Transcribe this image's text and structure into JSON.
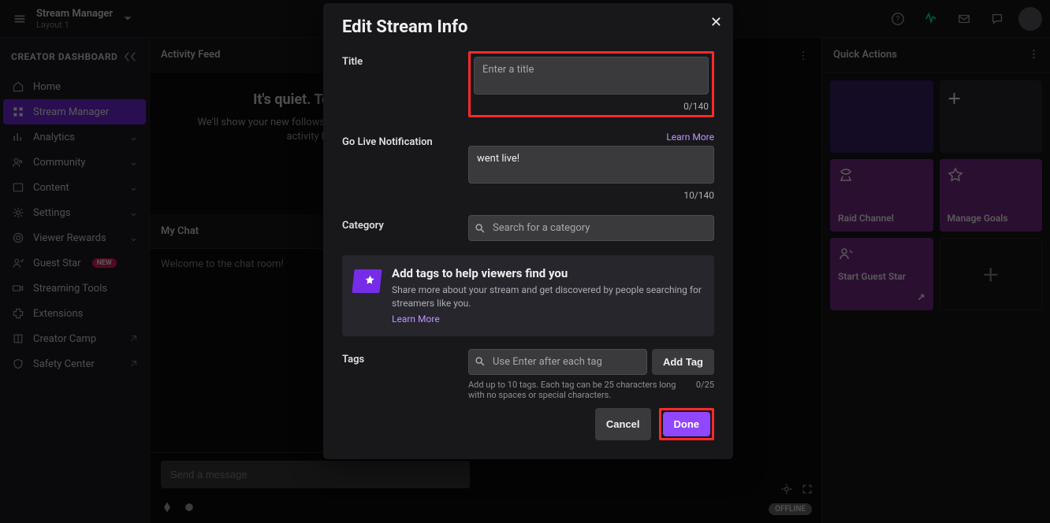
{
  "topbar": {
    "breadcrumb_main": "Stream Manager",
    "breadcrumb_sub": "Layout 1"
  },
  "sidebar": {
    "header": "CREATOR DASHBOARD",
    "items": [
      {
        "label": "Home",
        "icon": "home"
      },
      {
        "label": "Stream Manager",
        "icon": "grid",
        "active": true
      },
      {
        "label": "Analytics",
        "icon": "chart",
        "expandable": true
      },
      {
        "label": "Community",
        "icon": "people",
        "expandable": true
      },
      {
        "label": "Content",
        "icon": "content",
        "expandable": true
      },
      {
        "label": "Settings",
        "icon": "gear",
        "expandable": true
      },
      {
        "label": "Viewer Rewards",
        "icon": "reward",
        "expandable": true
      },
      {
        "label": "Guest Star",
        "icon": "guest",
        "badge": "NEW"
      },
      {
        "label": "Streaming Tools",
        "icon": "camera"
      },
      {
        "label": "Extensions",
        "icon": "ext"
      },
      {
        "label": "Creator Camp",
        "icon": "book",
        "external": true
      },
      {
        "label": "Safety Center",
        "icon": "shield",
        "external": true
      }
    ]
  },
  "activity": {
    "panel_title": "Activity Feed",
    "empty_heading": "It's quiet. Too quiet.",
    "empty_body": "We'll show your new follows, subs, cheers, and raids activity here."
  },
  "chat": {
    "panel_title": "My Chat",
    "welcome": "Welcome to the chat room!",
    "input_placeholder": "Send a message"
  },
  "preview": {
    "offline": "OFFLINE",
    "offline_pill": "OFFLINE"
  },
  "quick": {
    "panel_title": "Quick Actions",
    "tiles": [
      {
        "label": ""
      },
      {
        "label": ""
      },
      {
        "label": "Raid Channel"
      },
      {
        "label": "Manage Goals"
      },
      {
        "label": "Start Guest Star"
      }
    ]
  },
  "modal": {
    "title": "Edit Stream Info",
    "title_label": "Title",
    "title_placeholder": "Enter a title",
    "title_counter": "0/140",
    "golive_label": "Go Live Notification",
    "golive_learn": "Learn More",
    "golive_value": "went live!",
    "golive_counter": "10/140",
    "category_label": "Category",
    "category_placeholder": "Search for a category",
    "promo_heading": "Add tags to help viewers find you",
    "promo_body": "Share more about your stream and get discovered by people searching for streamers like you.",
    "promo_link": "Learn More",
    "tags_label": "Tags",
    "tags_placeholder": "Use Enter after each tag",
    "tags_addbtn": "Add Tag",
    "tags_help": "Add up to 10 tags. Each tag can be 25 characters long with no spaces or special characters.",
    "tags_counter": "0/25",
    "cancel": "Cancel",
    "done": "Done"
  }
}
